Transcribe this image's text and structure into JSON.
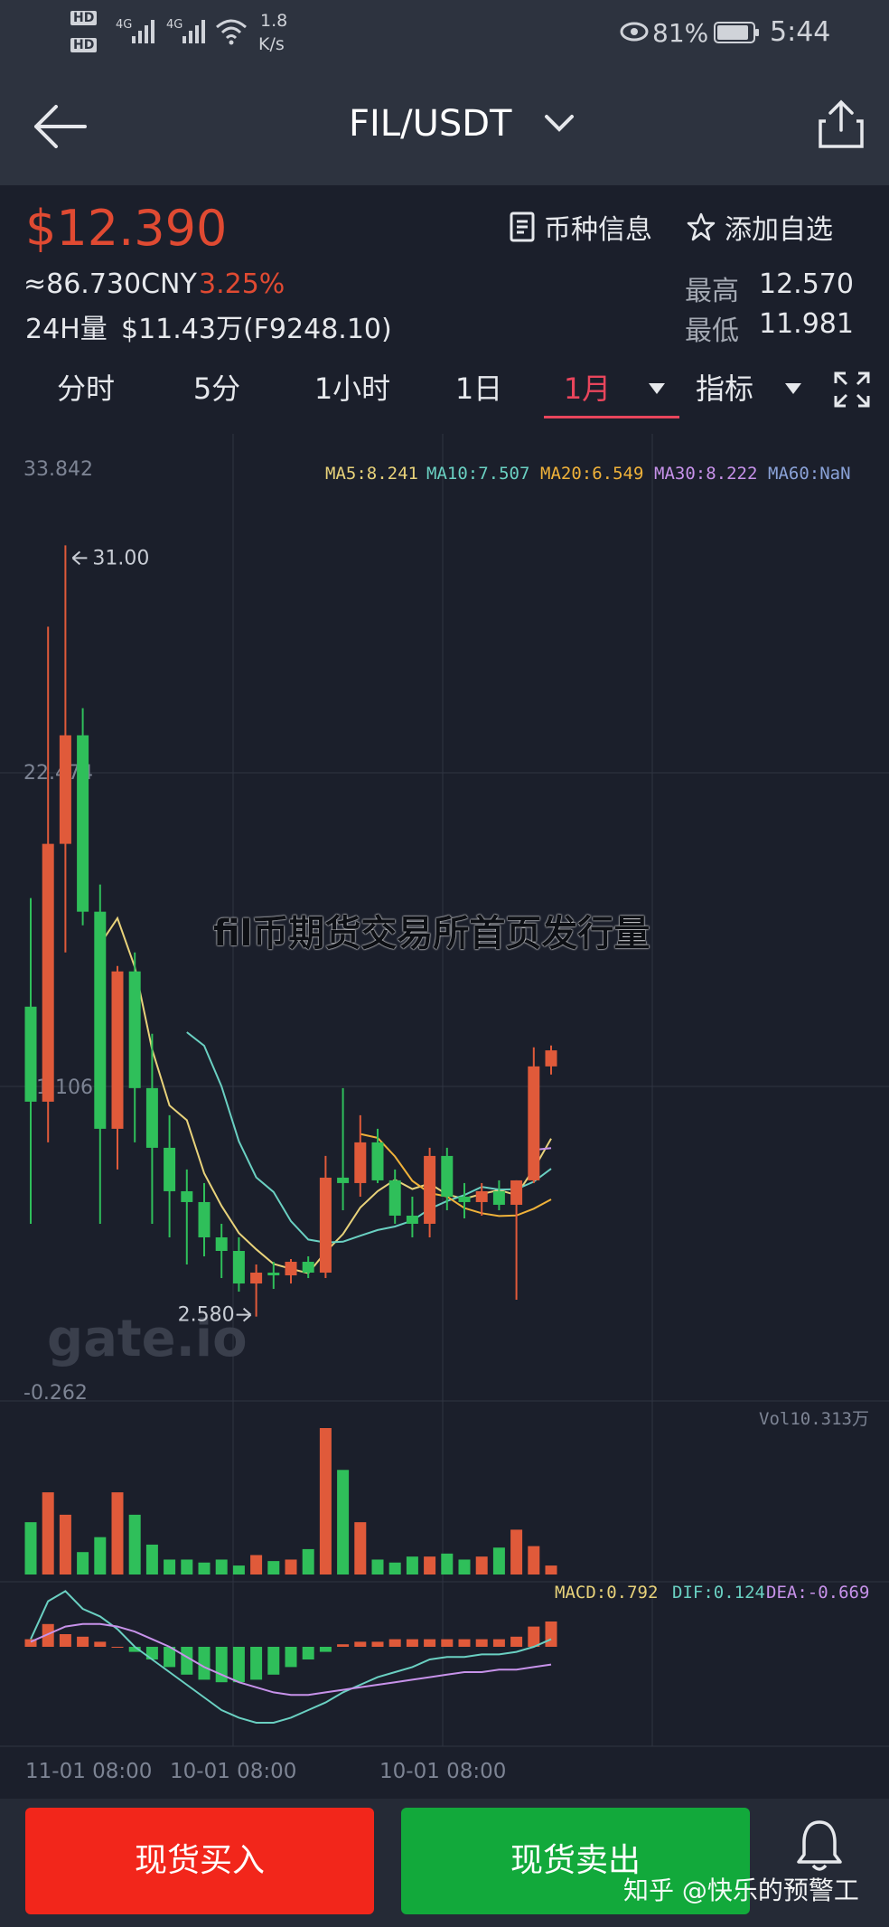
{
  "status_bar": {
    "hd1": "HD",
    "hd2": "HD",
    "net1": "4G",
    "net2": "4G",
    "speed_value": "1.8",
    "speed_unit": "K/s",
    "battery": "81%",
    "time": "5:44"
  },
  "header": {
    "title": "FIL/USDT"
  },
  "ticker": {
    "price": "$12.390",
    "cny": "≈86.730CNY",
    "change": "3.25%",
    "volume_label": "24H量",
    "volume_value": "$11.43万(F9248.10)",
    "info_button": "币种信息",
    "watch_button": "添加自选",
    "high_label": "最高",
    "high_value": "12.570",
    "low_label": "最低",
    "low_value": "11.981"
  },
  "tabs": {
    "items": [
      "分时",
      "5分",
      "1小时",
      "1日",
      "1月",
      "指标"
    ]
  },
  "indicators": {
    "ma5": "MA5:8.241",
    "ma10": "MA10:7.507",
    "ma20": "MA20:6.549",
    "ma30": "MA30:8.222",
    "ma60": "MA60:NaN",
    "vol": "Vol10.313万",
    "macd": "MACD:0.792",
    "dif": "DIF:0.124",
    "dea": "DEA:-0.669"
  },
  "colors": {
    "up": "#e05a3a",
    "down": "#2fbf5a",
    "ma5": "#e8d27a",
    "ma10": "#6ad0c2",
    "ma20": "#f0b23a",
    "ma30": "#c792ea",
    "ma60": "#8aa2d8"
  },
  "chart_data": {
    "type": "candlestick",
    "ylim": [
      -0.262,
      33.842
    ],
    "y_ticks": [
      "33.842",
      "22.474",
      "11.106",
      "-0.262"
    ],
    "high_marker": "31.00",
    "low_marker": "2.580",
    "x_ticks": [
      "11-01 08:00",
      "10-01 08:00",
      "10-01 08:00"
    ],
    "candles": [
      {
        "o": 14.0,
        "h": 18.0,
        "l": 6.0,
        "c": 10.5
      },
      {
        "o": 10.5,
        "h": 28.0,
        "l": 9.0,
        "c": 20.0
      },
      {
        "o": 20.0,
        "h": 31.0,
        "l": 16.0,
        "c": 24.0
      },
      {
        "o": 24.0,
        "h": 25.0,
        "l": 17.0,
        "c": 17.5
      },
      {
        "o": 17.5,
        "h": 18.5,
        "l": 6.0,
        "c": 9.5
      },
      {
        "o": 9.5,
        "h": 15.5,
        "l": 8.0,
        "c": 15.3
      },
      {
        "o": 15.3,
        "h": 16.0,
        "l": 9.0,
        "c": 11.0
      },
      {
        "o": 11.0,
        "h": 13.0,
        "l": 6.0,
        "c": 8.8
      },
      {
        "o": 8.8,
        "h": 10.0,
        "l": 5.5,
        "c": 7.2
      },
      {
        "o": 7.2,
        "h": 8.0,
        "l": 4.5,
        "c": 6.8
      },
      {
        "o": 6.8,
        "h": 7.5,
        "l": 4.8,
        "c": 5.5
      },
      {
        "o": 5.5,
        "h": 6.0,
        "l": 4.0,
        "c": 5.0
      },
      {
        "o": 5.0,
        "h": 5.5,
        "l": 3.5,
        "c": 3.8
      },
      {
        "o": 3.8,
        "h": 4.5,
        "l": 2.58,
        "c": 4.2
      },
      {
        "o": 4.2,
        "h": 4.6,
        "l": 3.6,
        "c": 4.1
      },
      {
        "o": 4.1,
        "h": 4.7,
        "l": 3.8,
        "c": 4.6
      },
      {
        "o": 4.6,
        "h": 4.8,
        "l": 4.0,
        "c": 4.2
      },
      {
        "o": 4.2,
        "h": 8.5,
        "l": 4.0,
        "c": 7.7
      },
      {
        "o": 7.7,
        "h": 11.0,
        "l": 6.5,
        "c": 7.5
      },
      {
        "o": 7.5,
        "h": 10.0,
        "l": 7.0,
        "c": 9.0
      },
      {
        "o": 9.0,
        "h": 9.5,
        "l": 7.5,
        "c": 7.6
      },
      {
        "o": 7.6,
        "h": 8.0,
        "l": 6.0,
        "c": 6.3
      },
      {
        "o": 6.3,
        "h": 7.0,
        "l": 5.5,
        "c": 6.0
      },
      {
        "o": 6.0,
        "h": 8.8,
        "l": 5.5,
        "c": 8.5
      },
      {
        "o": 8.5,
        "h": 8.8,
        "l": 6.5,
        "c": 7.0
      },
      {
        "o": 7.0,
        "h": 7.5,
        "l": 6.2,
        "c": 6.8
      },
      {
        "o": 6.8,
        "h": 7.5,
        "l": 6.3,
        "c": 7.2
      },
      {
        "o": 7.2,
        "h": 7.6,
        "l": 6.5,
        "c": 6.7
      },
      {
        "o": 6.7,
        "h": 7.6,
        "l": 3.2,
        "c": 7.6
      },
      {
        "o": 7.6,
        "h": 12.5,
        "l": 7.5,
        "c": 11.8
      },
      {
        "o": 11.8,
        "h": 12.57,
        "l": 11.5,
        "c": 12.39
      }
    ],
    "volume": [
      3.5,
      5.5,
      4.0,
      1.5,
      2.5,
      5.5,
      4.0,
      2.0,
      1.0,
      1.0,
      0.8,
      1.0,
      0.6,
      1.3,
      0.9,
      1.0,
      1.7,
      9.8,
      7.0,
      3.5,
      1.0,
      0.8,
      1.2,
      1.2,
      1.4,
      1.0,
      1.2,
      1.8,
      3.0,
      1.9,
      0.6
    ],
    "macd_hist": [
      0.3,
      0.9,
      0.5,
      0.4,
      0.2,
      0.0,
      -0.2,
      -0.5,
      -0.8,
      -1.1,
      -1.3,
      -1.4,
      -1.4,
      -1.3,
      -1.1,
      -0.8,
      -0.5,
      -0.2,
      0.1,
      0.2,
      0.2,
      0.3,
      0.3,
      0.3,
      0.3,
      0.3,
      0.3,
      0.3,
      0.4,
      0.8,
      1.0
    ],
    "dif": [
      0.3,
      1.8,
      2.2,
      1.5,
      1.2,
      0.7,
      0.0,
      -0.5,
      -1.0,
      -1.5,
      -2.0,
      -2.5,
      -2.8,
      -3.0,
      -3.0,
      -2.8,
      -2.5,
      -2.2,
      -1.8,
      -1.5,
      -1.2,
      -1.0,
      -0.8,
      -0.5,
      -0.4,
      -0.4,
      -0.3,
      -0.3,
      -0.2,
      0.0,
      0.3
    ],
    "dea": [
      0.2,
      0.5,
      0.8,
      0.9,
      0.9,
      0.8,
      0.6,
      0.3,
      0.0,
      -0.4,
      -0.8,
      -1.1,
      -1.4,
      -1.6,
      -1.8,
      -1.9,
      -1.9,
      -1.8,
      -1.7,
      -1.6,
      -1.5,
      -1.4,
      -1.3,
      -1.2,
      -1.1,
      -1.0,
      -1.0,
      -0.9,
      -0.9,
      -0.8,
      -0.7
    ]
  },
  "watermark": {
    "overlay_text": "fil币期货交易所首页发行量",
    "logo": "gate.io",
    "credit": "知乎 @快乐的预警工"
  },
  "bottom": {
    "buy": "现货买入",
    "sell": "现货卖出"
  }
}
